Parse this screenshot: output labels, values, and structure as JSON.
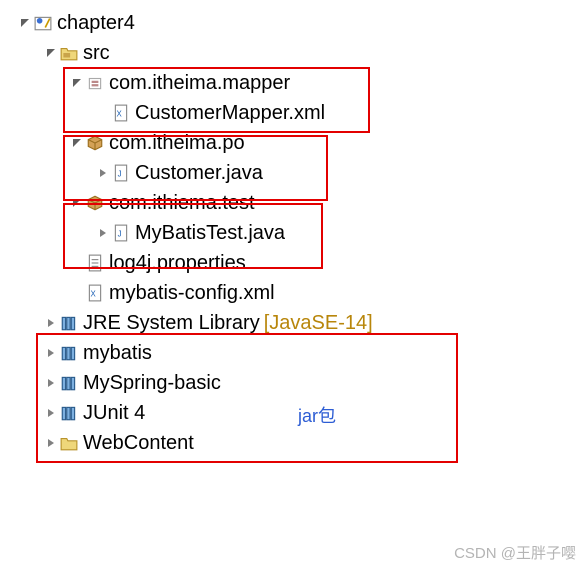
{
  "tree": {
    "project": "chapter4",
    "src": "src",
    "pkg_mapper": "com.itheima.mapper",
    "file_customermapper": "CustomerMapper.xml",
    "pkg_po": "com.itheima.po",
    "file_customer": "Customer.java",
    "pkg_test": "com.ithiema.test",
    "file_mybatistest": "MyBatisTest.java",
    "file_log4j": "log4j.properties",
    "file_mybatisconfig": "mybatis-config.xml",
    "lib_jre": "JRE System Library",
    "lib_jre_decorator": "[JavaSE-14]",
    "lib_mybatis": "mybatis",
    "lib_myspring": "MySpring-basic",
    "lib_junit": "JUnit 4",
    "webcontent": "WebContent"
  },
  "annotation": "jar包",
  "watermark": "CSDN @王胖子嘤"
}
